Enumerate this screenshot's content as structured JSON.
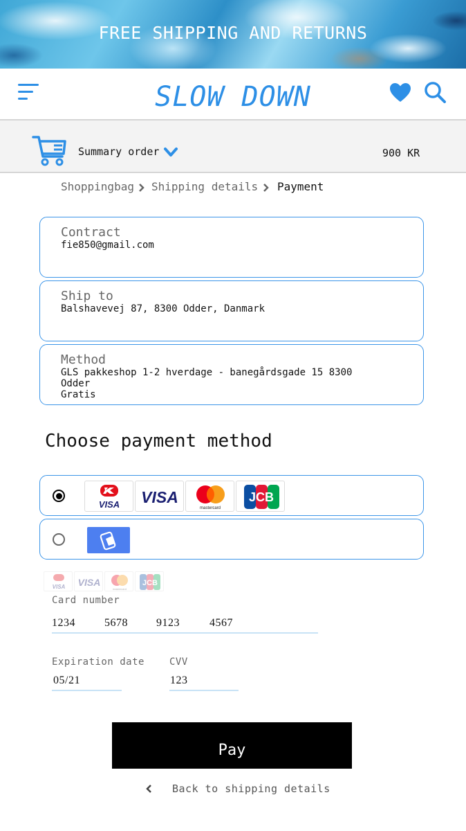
{
  "banner": {
    "text": "FREE SHIPPING AND RETURNS"
  },
  "header": {
    "brand": "SLOW DOWN",
    "accent_color": "#2d8fe6",
    "icons": [
      "menu-icon",
      "heart-icon",
      "search-icon"
    ]
  },
  "summary": {
    "label": "Summary order",
    "total": "900 KR",
    "icons": [
      "cart-icon",
      "chevron-down-icon"
    ]
  },
  "breadcrumb": {
    "items": [
      "Shoppingbag",
      "Shipping details",
      "Payment"
    ],
    "current": "Payment"
  },
  "contact": {
    "title": "Contract",
    "value": "fie850@gmail.com"
  },
  "ship_to": {
    "title": "Ship to",
    "value": "Balshavevej 87, 8300 Odder, Danmark"
  },
  "method": {
    "title": "Method",
    "line1": "GLS pakkeshop 1-2 hverdage - banegårdsgade 15 8300",
    "line2": "Odder",
    "line3": "Gratis"
  },
  "payment": {
    "heading": "Choose payment method",
    "options": [
      {
        "id": "cards",
        "selected": true,
        "logos": [
          "dankort-visa",
          "visa",
          "mastercard",
          "jcb"
        ]
      },
      {
        "id": "mobilepay",
        "selected": false,
        "logos": [
          "mobilepay"
        ]
      }
    ],
    "logo_text": {
      "visa": "VISA",
      "dankort_visa": "VISA",
      "mastercard": "mastercard",
      "jcb": "JCB"
    }
  },
  "card_form": {
    "card_number_label": "Card number",
    "card_number_groups": [
      "1234",
      "5678",
      "9123",
      "4567"
    ],
    "expiration_label": "Expiration date",
    "expiration_value": "05/21",
    "cvv_label": "CVV",
    "cvv_value": "123"
  },
  "actions": {
    "pay_label": "Pay",
    "back_label": "Back to shipping details"
  }
}
